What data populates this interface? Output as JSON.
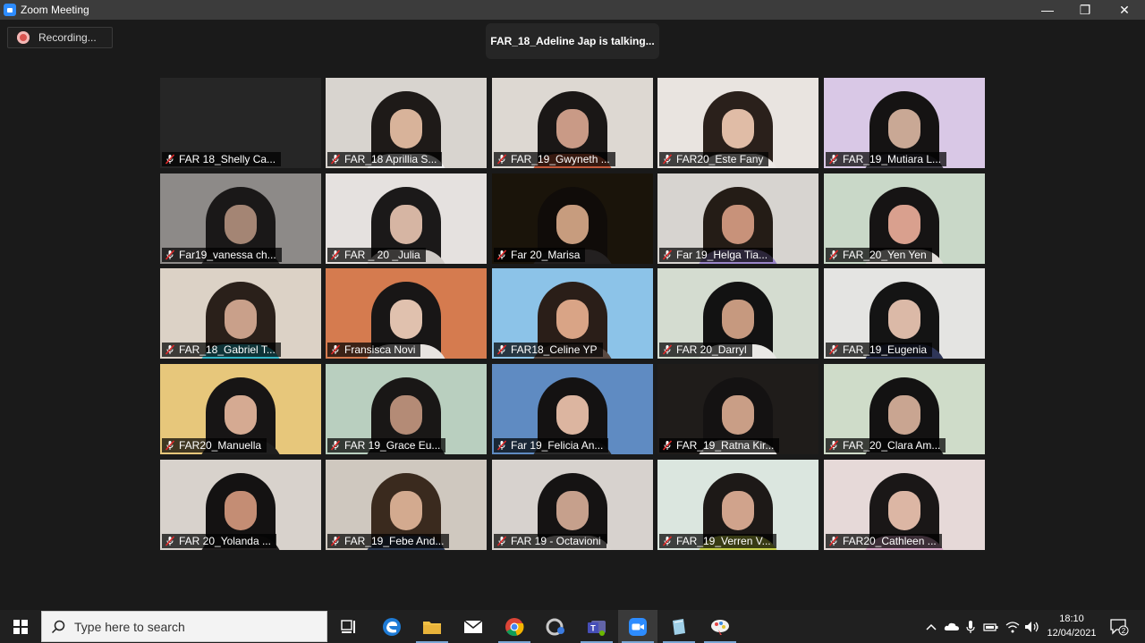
{
  "window": {
    "title": "Zoom Meeting",
    "minimize": "—",
    "restore": "❐",
    "close": "✕"
  },
  "recording": {
    "label": "Recording..."
  },
  "talking_banner": "FAR_18_Adeline Jap is talking...",
  "participants": [
    {
      "name": "FAR 18_Shelly Ca...",
      "bg": "#262626",
      "hair": "",
      "skin": "",
      "shirt": ""
    },
    {
      "name": "FAR_18 Aprillia S...",
      "bg": "#d8d4cf",
      "hair": "#1e1a18",
      "skin": "#d8b39a",
      "shirt": "#f0f0f0"
    },
    {
      "name": "FAR_19_Gwyneth ...",
      "bg": "#ddd8d2",
      "hair": "#1a1716",
      "skin": "#c99a86",
      "shirt": "#c45a3c"
    },
    {
      "name": "FAR20_Este Fany",
      "bg": "#e9e4e0",
      "hair": "#2a201b",
      "skin": "#e0bca6",
      "shirt": "#ede9e6"
    },
    {
      "name": "FAR_19_Mutiara L...",
      "bg": "#d9c8e6",
      "hair": "#151313",
      "skin": "#c9a895",
      "shirt": "#3a3840"
    },
    {
      "name": "Far19_vanessa ch...",
      "bg": "#8d8a88",
      "hair": "#1a1818",
      "skin": "#a48574",
      "shirt": "#2a2828"
    },
    {
      "name": "FAR _ 20 _Julia",
      "bg": "#e5e1df",
      "hair": "#1b1919",
      "skin": "#d6b5a3",
      "shirt": "#cfcac6"
    },
    {
      "name": "Far 20_Marisa",
      "bg": "#1a140a",
      "hair": "#100c09",
      "skin": "#c79c7e",
      "shirt": "#232020"
    },
    {
      "name": "Far 19_Helga Tia...",
      "bg": "#d7d4d0",
      "hair": "#241c16",
      "skin": "#c8927a",
      "shirt": "#9a86c9"
    },
    {
      "name": "FAR_20_Yen Yen",
      "bg": "#c9d8c8",
      "hair": "#161414",
      "skin": "#d9a08e",
      "shirt": "#e4e0dc"
    },
    {
      "name": "FAR_18_Gabriel T...",
      "bg": "#dcd2c6",
      "hair": "#2a201a",
      "skin": "#c9a08a",
      "shirt": "#33b7c7"
    },
    {
      "name": "Fransisca Novi",
      "bg": "#d57b4f",
      "hair": "#181616",
      "skin": "#e0c1ae",
      "shirt": "#e7e3e0"
    },
    {
      "name": "FAR18_Celine YP",
      "bg": "#8cc3e8",
      "hair": "#2a1e18",
      "skin": "#d9a486",
      "shirt": "#5a4a42"
    },
    {
      "name": "FAR 20_Darryl",
      "bg": "#d4dcd0",
      "hair": "#121212",
      "skin": "#c6997f",
      "shirt": "#e9e8e5"
    },
    {
      "name": "FAR_19_Eugenia",
      "bg": "#e4e4e2",
      "hair": "#141414",
      "skin": "#dbb9a7",
      "shirt": "#2f3658"
    },
    {
      "name": "FAR20_Manuella",
      "bg": "#e7c77b",
      "hair": "#171515",
      "skin": "#d5aa92",
      "shirt": "#1e1e1e"
    },
    {
      "name": "FAR 19_Grace Eu...",
      "bg": "#b9cfbf",
      "hair": "#191716",
      "skin": "#b48b76",
      "shirt": "#1b1b1b"
    },
    {
      "name": "Far 19_Felicia An...",
      "bg": "#5f8bc2",
      "hair": "#141212",
      "skin": "#dcb5a0",
      "shirt": "#2a2a2a"
    },
    {
      "name": "FAR_19_Ratna Kir...",
      "bg": "#1f1c1a",
      "hair": "#141212",
      "skin": "#c99e86",
      "shirt": "#e9e6e3"
    },
    {
      "name": "FAR_20_Clara Am...",
      "bg": "#cfdcc9",
      "hair": "#131212",
      "skin": "#c9a591",
      "shirt": "#1c1c1c"
    },
    {
      "name": "FAR 20_Yolanda ...",
      "bg": "#d8d2cc",
      "hair": "#141212",
      "skin": "#c48d74",
      "shirt": "#221f1f"
    },
    {
      "name": "FAR_19_Febe And...",
      "bg": "#cfc8bf",
      "hair": "#3a2a1e",
      "skin": "#d3aa8f",
      "shirt": "#2b3a55"
    },
    {
      "name": "FAR 19 - Octavioni",
      "bg": "#d7d2ce",
      "hair": "#151313",
      "skin": "#c6a08c",
      "shirt": "#d9d4d0"
    },
    {
      "name": "FAR_19_Verren V...",
      "bg": "#dbe6df",
      "hair": "#1d1917",
      "skin": "#d0a38c",
      "shirt": "#c9d24a"
    },
    {
      "name": "FAR20_Cathleen ...",
      "bg": "#e6d9d8",
      "hair": "#1a1717",
      "skin": "#dcb6a4",
      "shirt": "#d6a6c6"
    }
  ],
  "taskbar": {
    "search_placeholder": "Type here to search",
    "apps": [
      "task-view-icon",
      "edge-icon",
      "file-explorer-icon",
      "mail-icon",
      "chrome-icon",
      "app-icon",
      "teams-icon",
      "zoom-icon",
      "notes-icon",
      "paint-icon"
    ],
    "time": "18:10",
    "date": "12/04/2021",
    "notifications": "2"
  }
}
